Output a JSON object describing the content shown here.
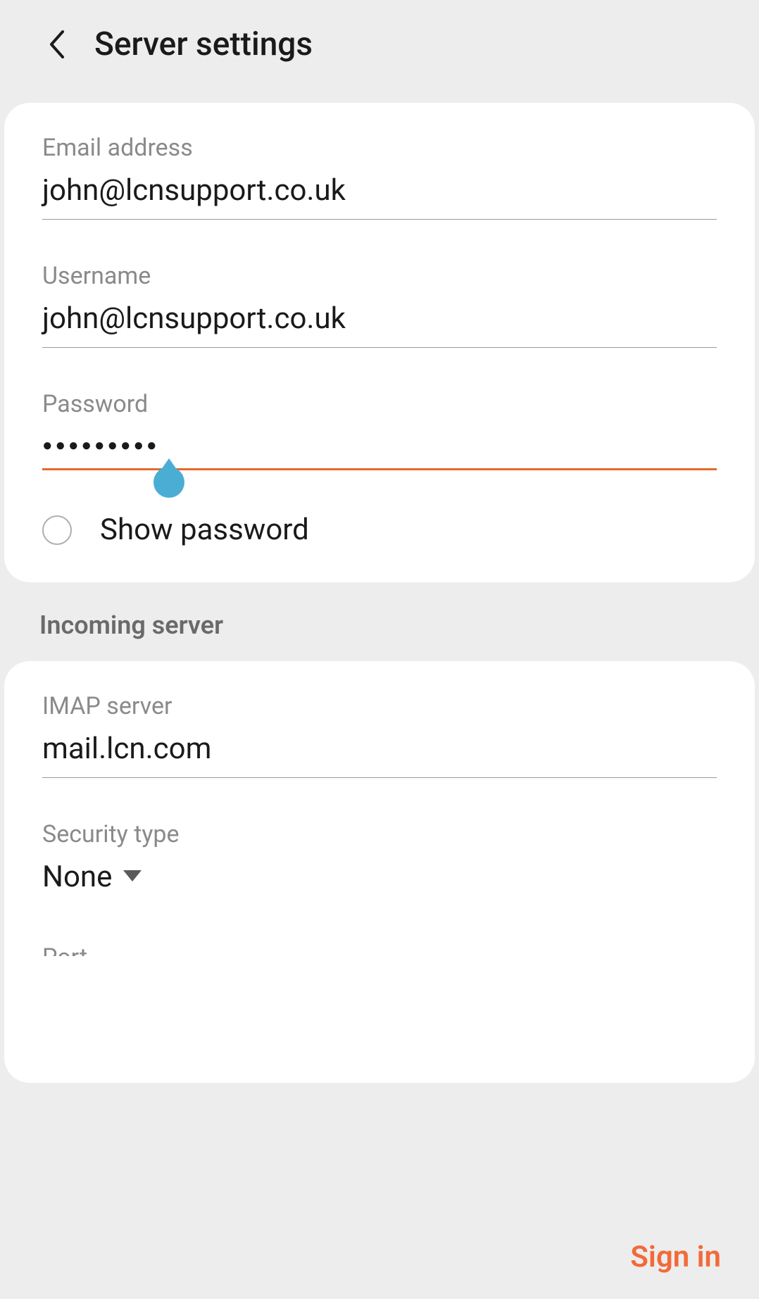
{
  "header": {
    "title": "Server settings"
  },
  "fields": {
    "email": {
      "label": "Email address",
      "value": "john@lcnsupport.co.uk"
    },
    "username": {
      "label": "Username",
      "value": "john@lcnsupport.co.uk"
    },
    "password": {
      "label": "Password",
      "value": "●●●●●●●●●"
    },
    "show_password": {
      "label": "Show password"
    }
  },
  "incoming": {
    "section_title": "Incoming server",
    "imap": {
      "label": "IMAP server",
      "value": "mail.lcn.com"
    },
    "security": {
      "label": "Security type",
      "value": "None"
    },
    "port": {
      "label": "Port"
    }
  },
  "footer": {
    "sign_in": "Sign in"
  }
}
